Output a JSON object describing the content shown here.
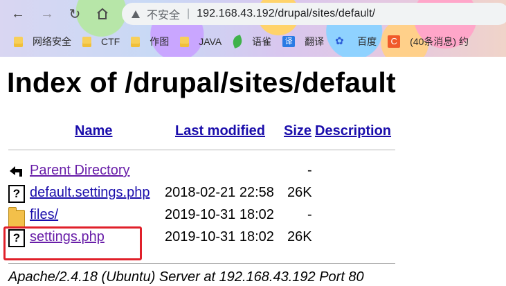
{
  "browser": {
    "security_label": "不安全",
    "separator": "|",
    "url": "192.168.43.192/drupal/sites/default/"
  },
  "bookmarks": [
    {
      "label": "网络安全",
      "icon": "folder-icon"
    },
    {
      "label": "CTF",
      "icon": "folder-icon"
    },
    {
      "label": "作图",
      "icon": "folder-icon"
    },
    {
      "label": "JAVA",
      "icon": "folder-icon"
    },
    {
      "label": "语雀",
      "icon": "yuque-leaf-icon"
    },
    {
      "label": "翻译",
      "icon": "fanyi-icon",
      "glyph": "译"
    },
    {
      "label": "百度",
      "icon": "baidu-paw-icon"
    },
    {
      "label": "(40条消息) 约",
      "icon": "csdn-icon",
      "glyph": "C"
    }
  ],
  "page": {
    "title": "Index of /drupal/sites/default",
    "columns": {
      "name": "Name",
      "last_modified": "Last modified",
      "size": "Size",
      "description": "Description"
    },
    "rows": [
      {
        "name": "Parent Directory",
        "date": "",
        "size": "-",
        "icon": "back-arrow-icon"
      },
      {
        "name": "default.settings.php",
        "date": "2018-02-21 22:58",
        "size": "26K",
        "icon": "unknown-file-icon"
      },
      {
        "name": "files/",
        "date": "2019-10-31 18:02",
        "size": "-",
        "icon": "folder-icon"
      },
      {
        "name": "settings.php",
        "date": "2019-10-31 18:02",
        "size": "26K",
        "icon": "unknown-file-icon"
      }
    ],
    "footer": "Apache/2.4.18 (Ubuntu) Server at 192.168.43.192 Port 80"
  },
  "colors": {
    "link": "#1a0dab",
    "visited_link": "#681da8",
    "highlight_box": "#e0202a"
  }
}
